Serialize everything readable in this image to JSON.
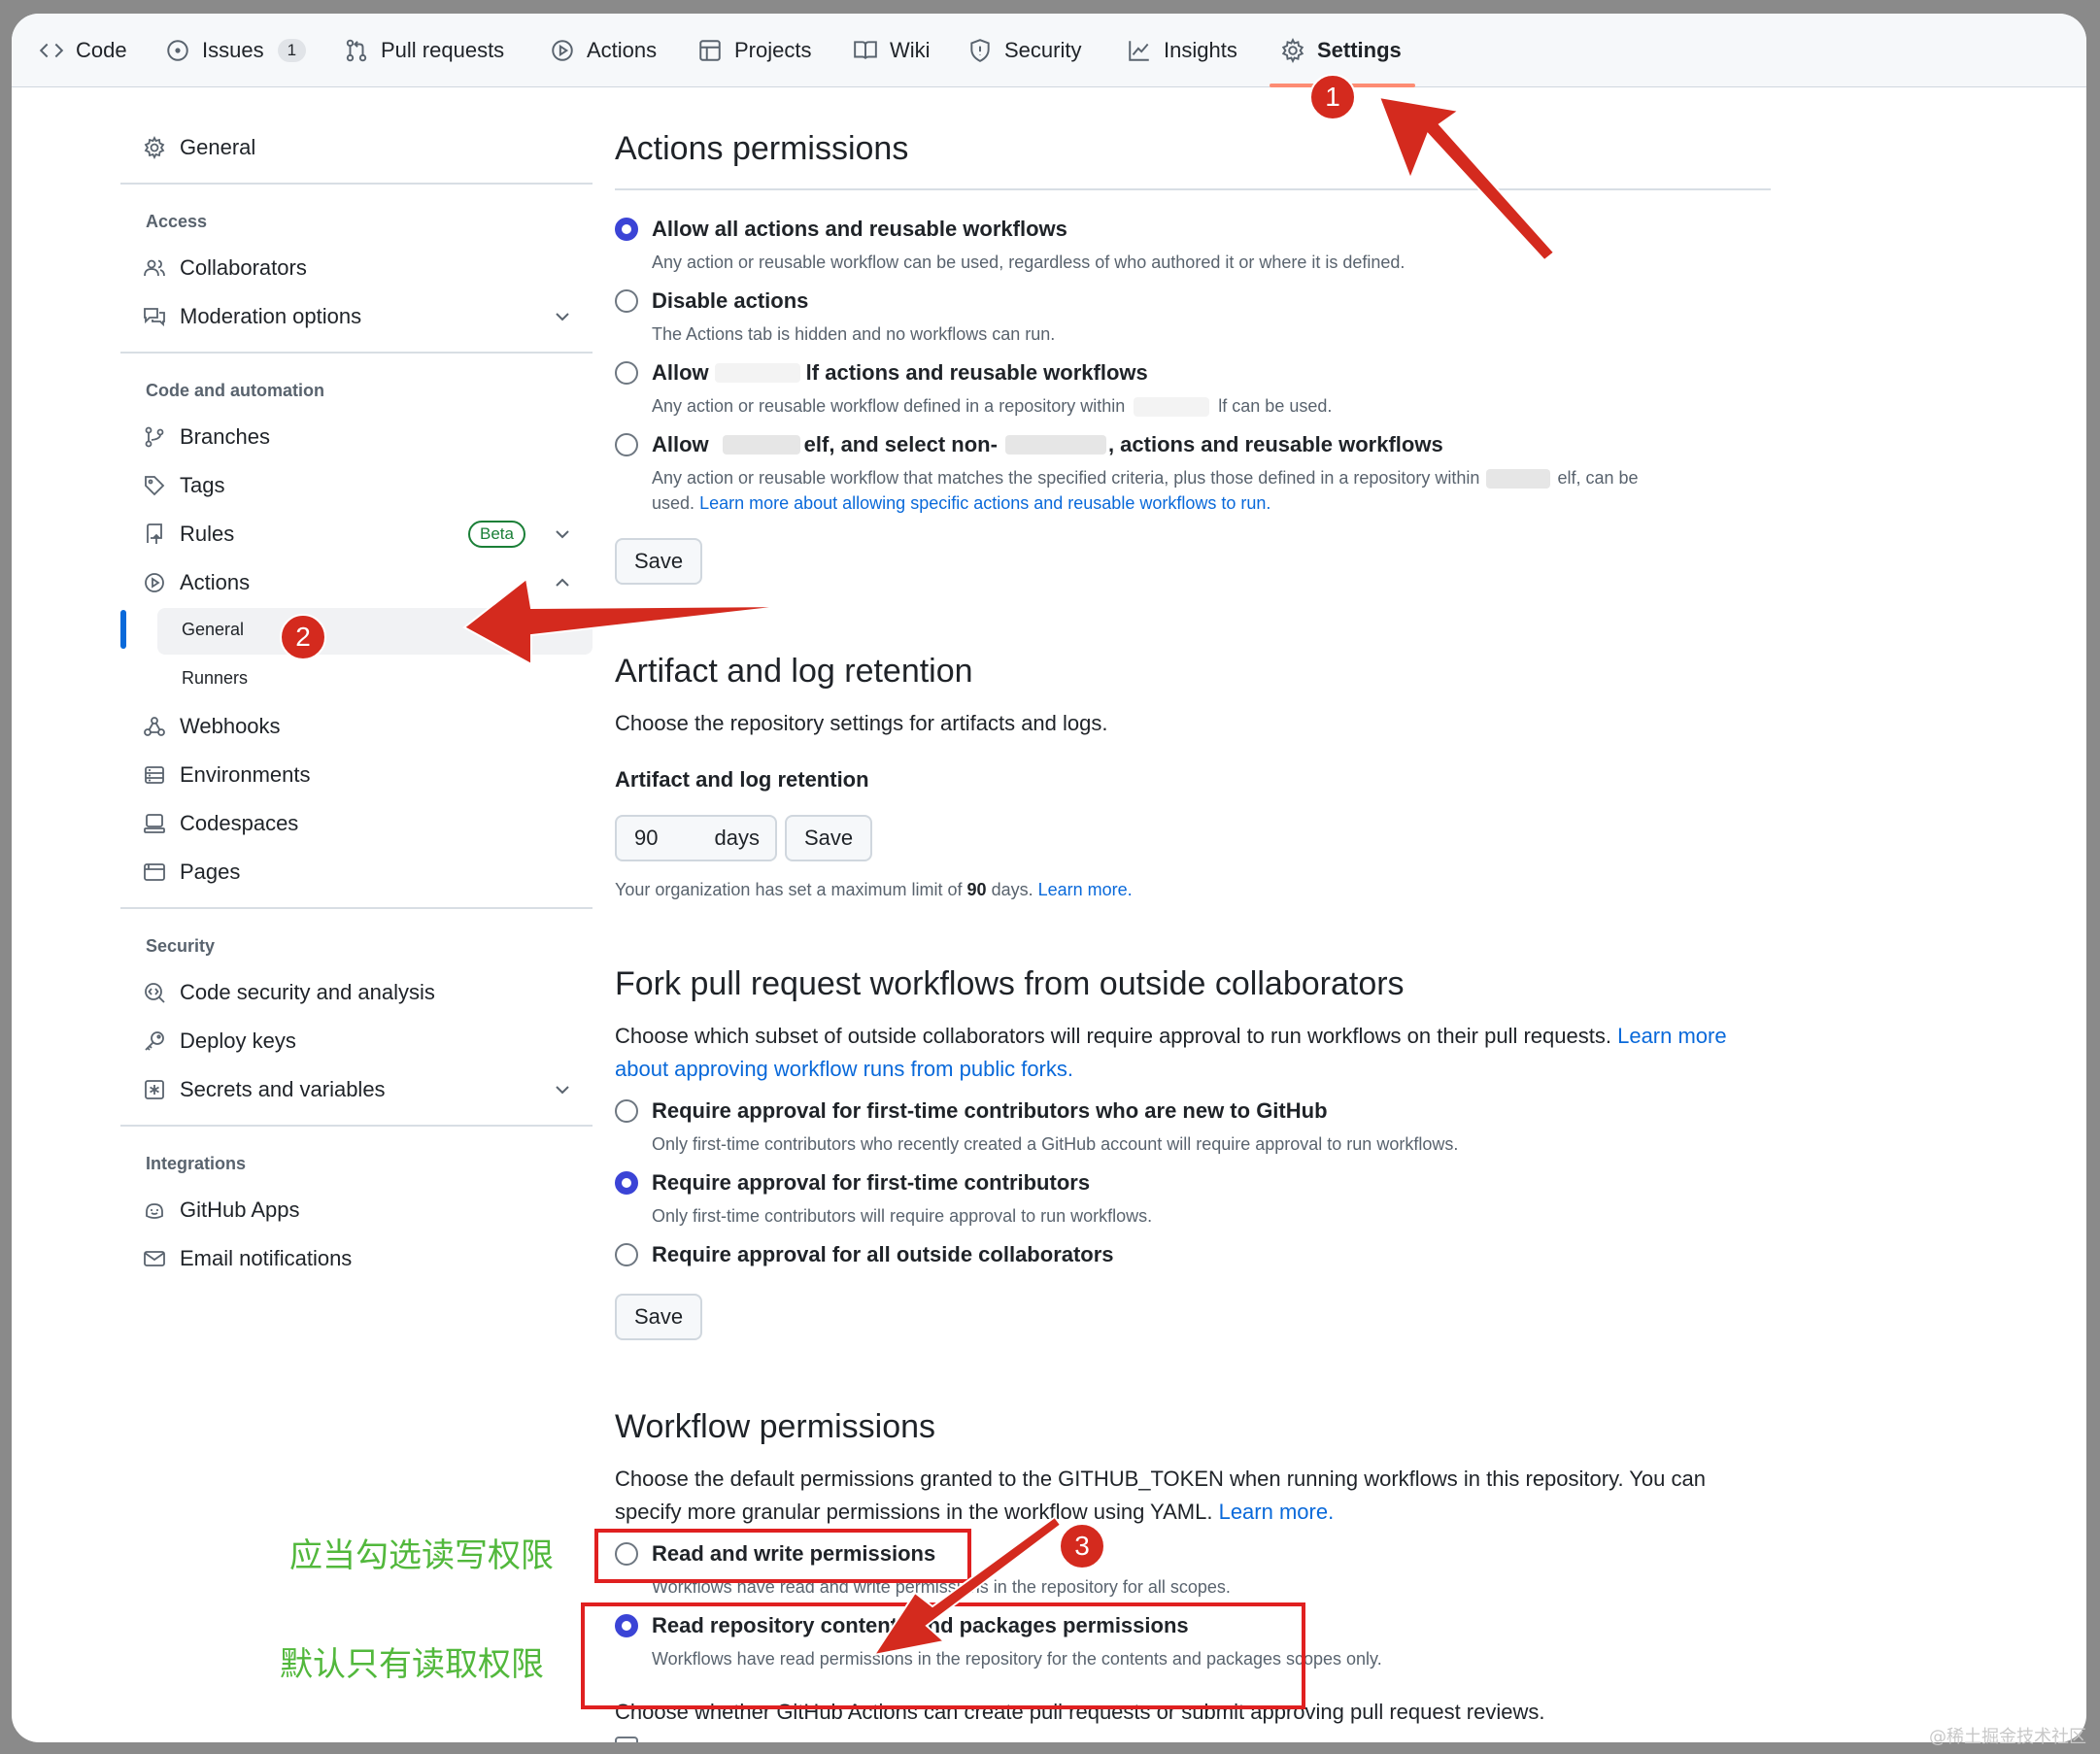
{
  "nav": {
    "tabs": [
      {
        "label": "Code",
        "icon": "code-icon"
      },
      {
        "label": "Issues",
        "icon": "issue-icon",
        "count": "1"
      },
      {
        "label": "Pull requests",
        "icon": "pull-request-icon"
      },
      {
        "label": "Actions",
        "icon": "play-icon"
      },
      {
        "label": "Projects",
        "icon": "table-icon"
      },
      {
        "label": "Wiki",
        "icon": "book-icon"
      },
      {
        "label": "Security",
        "icon": "shield-icon"
      },
      {
        "label": "Insights",
        "icon": "graph-icon"
      },
      {
        "label": "Settings",
        "icon": "gear-icon",
        "active": true
      }
    ]
  },
  "sidebar": {
    "general": "General",
    "access_heading": "Access",
    "collaborators": "Collaborators",
    "moderation": "Moderation options",
    "code_heading": "Code and automation",
    "branches": "Branches",
    "tags": "Tags",
    "rules": "Rules",
    "beta": "Beta",
    "actions": "Actions",
    "actions_general": "General",
    "actions_runners": "Runners",
    "webhooks": "Webhooks",
    "environments": "Environments",
    "codespaces": "Codespaces",
    "pages": "Pages",
    "security_heading": "Security",
    "code_security": "Code security and analysis",
    "deploy_keys": "Deploy keys",
    "secrets": "Secrets and variables",
    "integrations_heading": "Integrations",
    "github_apps": "GitHub Apps",
    "email": "Email notifications"
  },
  "actions_permissions": {
    "title": "Actions permissions",
    "opt1": "Allow all actions and reusable workflows",
    "opt1_desc": "Any action or reusable workflow can be used, regardless of who authored it or where it is defined.",
    "opt2": "Disable actions",
    "opt2_desc": "The Actions tab is hidden and no workflows can run.",
    "opt3_a": "Allow",
    "opt3_b": "lf actions and reusable workflows",
    "opt3_desc_a": "Any action or reusable workflow defined in a repository within",
    "opt3_desc_b": "lf can be used.",
    "opt4_a": "Allow",
    "opt4_b": "elf, and select non-",
    "opt4_c": ", actions and reusable workflows",
    "opt4_desc_a": "Any action or reusable workflow that matches the specified criteria, plus those defined in a repository within",
    "opt4_desc_b": "elf, can be",
    "opt4_desc_c": "used.",
    "opt4_link": "Learn more about allowing specific actions and reusable workflows to run.",
    "save": "Save"
  },
  "artifact": {
    "title": "Artifact and log retention",
    "desc": "Choose the repository settings for artifacts and logs.",
    "label": "Artifact and log retention",
    "value": "90",
    "unit": "days",
    "save": "Save",
    "note_a": "Your organization has set a maximum limit of",
    "note_b": "90",
    "note_c": "days.",
    "note_link": "Learn more."
  },
  "fork": {
    "title": "Fork pull request workflows from outside collaborators",
    "desc_a": "Choose which subset of outside collaborators will require approval to run workflows on their pull requests.",
    "desc_link_a": "Learn more",
    "desc_link_b": "about approving workflow runs from public forks.",
    "opt1": "Require approval for first-time contributors who are new to GitHub",
    "opt1_desc": "Only first-time contributors who recently created a GitHub account will require approval to run workflows.",
    "opt2": "Require approval for first-time contributors",
    "opt2_desc": "Only first-time contributors will require approval to run workflows.",
    "opt3": "Require approval for all outside collaborators",
    "save": "Save"
  },
  "workflow": {
    "title": "Workflow permissions",
    "desc_a": "Choose the default permissions granted to the GITHUB_TOKEN when running workflows in this repository. You can",
    "desc_b": "specify more granular permissions in the workflow using YAML.",
    "desc_link": "Learn more.",
    "opt1": "Read and write permissions",
    "opt1_desc": "Workflows have read and write permissions in the repository for all scopes.",
    "opt2": "Read repository contents and packages permissions",
    "opt2_desc": "Workflows have read permissions in the repository for the contents and packages scopes only.",
    "pr_desc": "Choose whether GitHub Actions can create pull requests or submit approving pull request reviews."
  },
  "annotations": {
    "badge1": "1",
    "badge2": "2",
    "badge3": "3",
    "note_should": "应当勾选读写权限",
    "note_default": "默认只有读取权限",
    "accent": "#d42a1e",
    "note_color": "#52b83c"
  },
  "watermark": "@稀土掘金技术社区"
}
